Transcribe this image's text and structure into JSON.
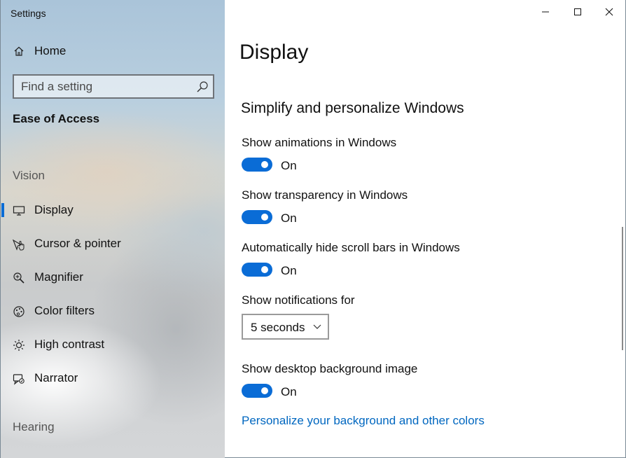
{
  "window": {
    "title": "Settings"
  },
  "sidebar": {
    "home_label": "Home",
    "search_placeholder": "Find a setting",
    "section_heading": "Ease of Access",
    "groups": [
      {
        "label": "Vision"
      },
      {
        "label": "Hearing"
      }
    ],
    "items": [
      {
        "label": "Display",
        "icon": "monitor-icon",
        "selected": true
      },
      {
        "label": "Cursor & pointer",
        "icon": "cursor-pointer-icon",
        "selected": false
      },
      {
        "label": "Magnifier",
        "icon": "magnifier-icon",
        "selected": false
      },
      {
        "label": "Color filters",
        "icon": "color-filters-icon",
        "selected": false
      },
      {
        "label": "High contrast",
        "icon": "high-contrast-icon",
        "selected": false
      },
      {
        "label": "Narrator",
        "icon": "narrator-icon",
        "selected": false
      }
    ]
  },
  "main": {
    "title": "Display",
    "subtitle": "Simplify and personalize Windows",
    "settings": [
      {
        "label": "Show animations in Windows",
        "state": "On"
      },
      {
        "label": "Show transparency in Windows",
        "state": "On"
      },
      {
        "label": "Automatically hide scroll bars in Windows",
        "state": "On"
      },
      {
        "label": "Show desktop background image",
        "state": "On"
      }
    ],
    "notifications": {
      "label": "Show notifications for",
      "selected": "5 seconds"
    },
    "link": "Personalize your background and other colors"
  },
  "colors": {
    "accent": "#0a6cd6",
    "link": "#0067c0"
  }
}
